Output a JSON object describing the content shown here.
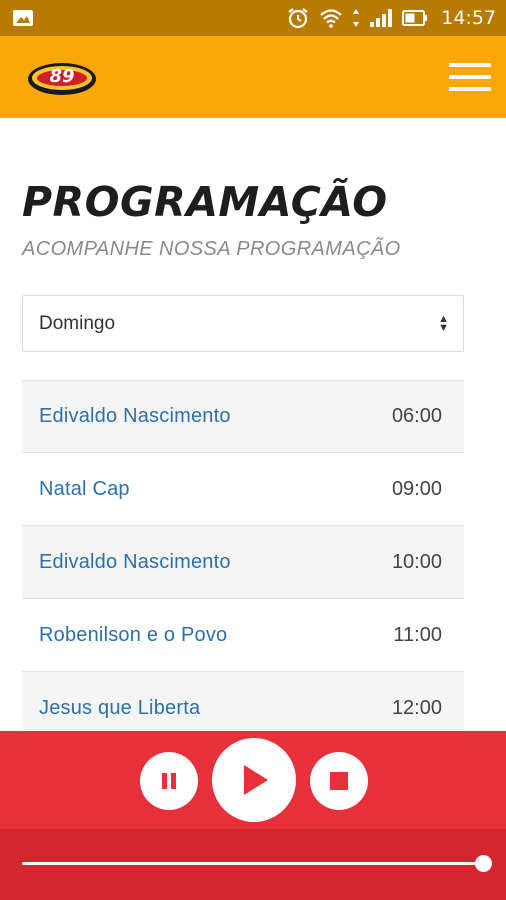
{
  "status_bar": {
    "time": "14:57",
    "icons": [
      "image-icon",
      "alarm-icon",
      "wifi-icon",
      "data-arrows-icon",
      "signal-icon",
      "battery-icon"
    ]
  },
  "header": {
    "logo_text": "89",
    "menu_icon": "hamburger-menu-icon",
    "background": "#f9a806"
  },
  "main": {
    "title": "PROGRAMAÇÃO",
    "subtitle": "ACOMPANHE NOSSA PROGRAMAÇÃO",
    "day_select": {
      "selected": "Domingo"
    },
    "schedule": [
      {
        "name": "Edivaldo Nascimento",
        "time": "06:00"
      },
      {
        "name": "Natal Cap",
        "time": "09:00"
      },
      {
        "name": "Edivaldo Nascimento",
        "time": "10:00"
      },
      {
        "name": "Robenilson e o Povo",
        "time": "11:00"
      },
      {
        "name": "Jesus que Liberta",
        "time": "12:00"
      }
    ]
  },
  "player": {
    "buttons": [
      "pause-icon",
      "play-icon",
      "stop-icon"
    ],
    "progress": 1.0,
    "background": "#e8303a"
  },
  "colors": {
    "status_bar": "#b87a00",
    "link": "#2f70a8",
    "player_dark": "#d3262f"
  }
}
